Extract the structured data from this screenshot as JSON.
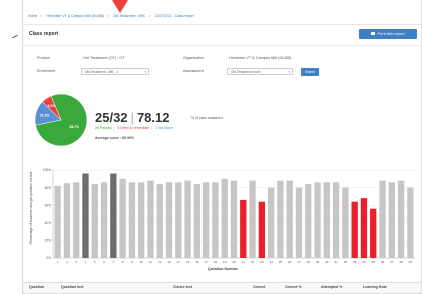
{
  "breadcrumb": [
    "Home",
    "Hershiser VT & Campus 666 (01456)",
    "Old Testament : ARC",
    "11/07/2021 : Class report"
  ],
  "page_title": "Class report",
  "print_button": "Print this report",
  "filters": {
    "product_label": "Product",
    "product_value": "Old Testament (OT) : OT",
    "enrollment_label": "Enrollment",
    "enrollment_value": "Old Testament - Mill... 1",
    "organization_label": "Organization",
    "organization_value": "Hershiser VT & Campus 666 (01456)",
    "assessment_label": "Assessment",
    "assessment_value": "Old Testament Exam",
    "search_label": "Search"
  },
  "summary": {
    "fraction": "25/32",
    "percent": "78.12",
    "percent_suffix": "% of class mastered",
    "passed": "25 Passed",
    "remediate": "5 Need to remediate",
    "not_taken": "2 Not taken",
    "average": "Average score : 85.99%"
  },
  "pie": {
    "segments": [
      {
        "label": "",
        "value": 78.1,
        "color": "#3aa83a",
        "text": "68.7%"
      },
      {
        "label": "",
        "value": 15.6,
        "color": "#5b8fd6",
        "text": "31.3%"
      },
      {
        "label": "",
        "value": 6.3,
        "color": "#e8403c",
        "text": "6.3%"
      }
    ]
  },
  "chart_data": {
    "type": "bar",
    "title": "",
    "xlabel": "Question Number",
    "ylabel": "Percentage of students who got question correct",
    "ylim": [
      0,
      100
    ],
    "yticks": [
      "0%",
      "20%",
      "40%",
      "60%",
      "80%",
      "100%"
    ],
    "categories": [
      "1",
      "2",
      "3",
      "4",
      "5",
      "6",
      "7",
      "8",
      "9",
      "10",
      "11",
      "12",
      "13",
      "14",
      "15",
      "16",
      "17",
      "18",
      "19",
      "20",
      "21",
      "22",
      "23",
      "24",
      "25",
      "26",
      "27",
      "28",
      "29",
      "30",
      "31",
      "32",
      "33",
      "34",
      "35",
      "36",
      "37",
      "38",
      "39"
    ],
    "values": [
      82,
      85,
      86,
      96,
      84,
      86,
      96,
      90,
      86,
      86,
      88,
      84,
      86,
      86,
      88,
      84,
      86,
      86,
      90,
      88,
      66,
      88,
      64,
      80,
      88,
      88,
      80,
      84,
      86,
      86,
      86,
      80,
      64,
      68,
      56,
      88,
      86,
      88,
      80
    ],
    "colors": [
      "#c6c6c6",
      "#c6c6c6",
      "#c6c6c6",
      "#6d6d6d",
      "#c6c6c6",
      "#c6c6c6",
      "#6d6d6d",
      "#c6c6c6",
      "#c6c6c6",
      "#c6c6c6",
      "#c6c6c6",
      "#c6c6c6",
      "#c6c6c6",
      "#c6c6c6",
      "#c6c6c6",
      "#c6c6c6",
      "#c6c6c6",
      "#c6c6c6",
      "#c6c6c6",
      "#c6c6c6",
      "#e8202a",
      "#c6c6c6",
      "#e8202a",
      "#c6c6c6",
      "#c6c6c6",
      "#c6c6c6",
      "#c6c6c6",
      "#c6c6c6",
      "#c6c6c6",
      "#c6c6c6",
      "#c6c6c6",
      "#c6c6c6",
      "#e8202a",
      "#e8202a",
      "#e8202a",
      "#c6c6c6",
      "#c6c6c6",
      "#c6c6c6",
      "#c6c6c6"
    ],
    "grid": true
  },
  "table": {
    "columns": [
      "Question",
      "Question text",
      "Choice text",
      "Correct",
      "Correct %",
      "Attempted %",
      "Learning Goal"
    ]
  }
}
